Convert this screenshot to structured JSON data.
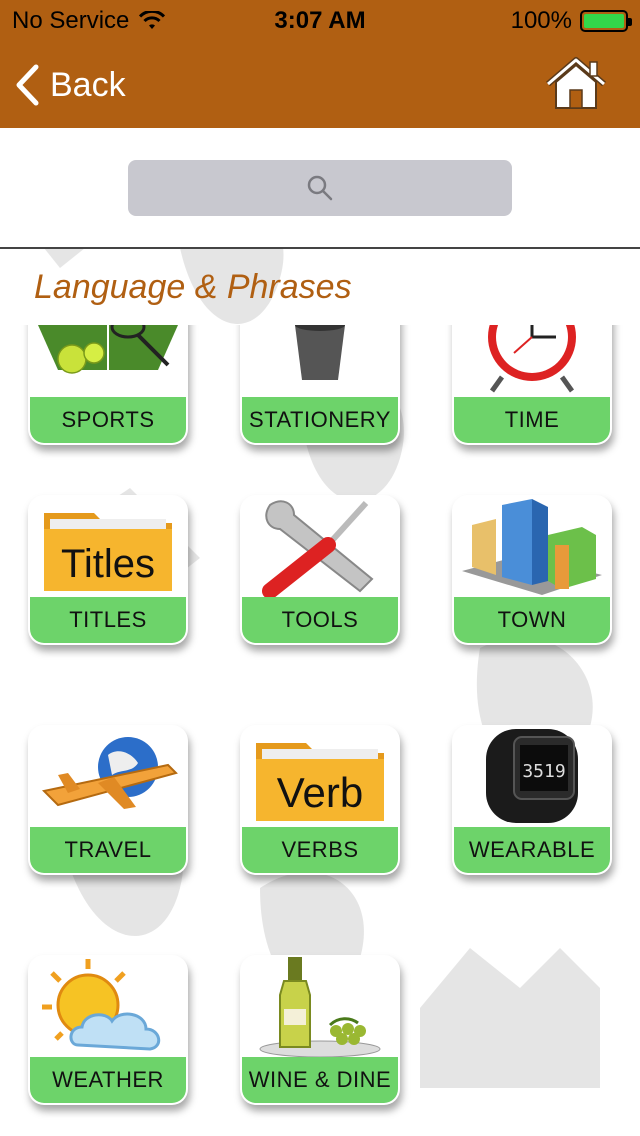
{
  "status_bar": {
    "carrier": "No Service",
    "time": "3:07 AM",
    "battery_percent": "100%",
    "battery_level": 1.0
  },
  "nav": {
    "back_label": "Back",
    "home_icon": "home-icon"
  },
  "search": {
    "placeholder": "",
    "icon": "search-icon"
  },
  "section": {
    "title": "Language & Phrases"
  },
  "categories": [
    {
      "label": "SPORTS",
      "icon": "tennis-court-icon"
    },
    {
      "label": "STATIONERY",
      "icon": "pencil-cup-icon"
    },
    {
      "label": "TIME",
      "icon": "alarm-clock-icon"
    },
    {
      "label": "TITLES",
      "icon": "folder-titles-icon",
      "icon_text": "Titles"
    },
    {
      "label": "TOOLS",
      "icon": "wrench-screwdriver-icon"
    },
    {
      "label": "TOWN",
      "icon": "buildings-icon"
    },
    {
      "label": "TRAVEL",
      "icon": "airplane-globe-icon"
    },
    {
      "label": "VERBS",
      "icon": "folder-verb-icon",
      "icon_text": "Verb"
    },
    {
      "label": "WEARABLE",
      "icon": "fitness-watch-icon",
      "icon_text": "3519"
    },
    {
      "label": "WEATHER",
      "icon": "sun-cloud-icon"
    },
    {
      "label": "WINE & DINE",
      "icon": "wine-bottle-icon"
    }
  ],
  "colors": {
    "brand": "#b05f12",
    "tile_label_bg": "#6dd36a",
    "search_bg": "#c8c8cf",
    "battery_fill": "#33d64a"
  }
}
